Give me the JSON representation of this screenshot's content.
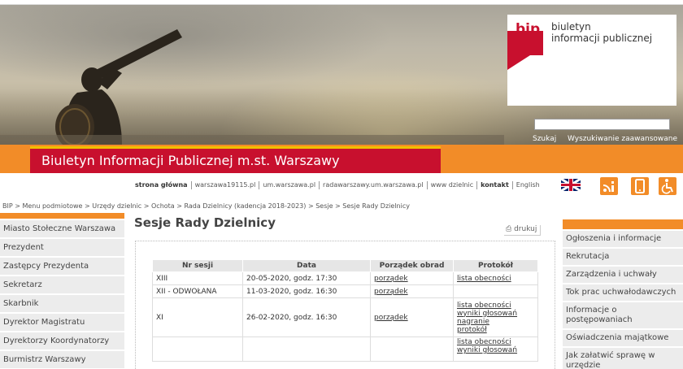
{
  "header": {
    "bip_logo_word": "bip",
    "bip_logo_text_line1": "biuletyn",
    "bip_logo_text_line2": "informacji publicznej",
    "search_label": "Szukaj",
    "advanced_search_label": "Wyszukiwanie zaawansowane",
    "site_title": "Biuletyn Informacji Publicznej m.st. Warszawy"
  },
  "topnav": {
    "items": [
      "strona główna",
      "warszawa19115.pl",
      "um.warszawa.pl",
      "radawarszawy.um.warszawa.pl",
      "www dzielnic",
      "kontakt",
      "English"
    ]
  },
  "icons": {
    "rss": "rss-icon",
    "mobile": "mobile-icon",
    "accessibility": "accessibility-icon",
    "flag": "uk-flag-icon",
    "print": "print-icon"
  },
  "breadcrumb": {
    "items": [
      "BIP",
      "Menu podmiotowe",
      "Urzędy dzielnic",
      "Ochota",
      "Rada Dzielnicy (kadencja 2018-2023)",
      "Sesje",
      "Sesje Rady Dzielnicy"
    ],
    "separator": ">"
  },
  "left_sidebar": {
    "items": [
      "Miasto Stołeczne Warszawa",
      "Prezydent",
      "Zastępcy Prezydenta",
      "Sekretarz",
      "Skarbnik",
      "Dyrektor Magistratu",
      "Dyrektorzy Koordynatorzy",
      "Burmistrz Warszawy"
    ]
  },
  "main": {
    "title": "Sesje Rady Dzielnicy",
    "print_label": "drukuj",
    "table": {
      "headers": [
        "Nr sesji",
        "Data",
        "Porządek obrad",
        "Protokół"
      ],
      "rows": [
        {
          "nr": "XIII",
          "data": "20-05-2020, godz. 17:30",
          "porzadek": "porządek",
          "protokol": [
            "lista obecności"
          ]
        },
        {
          "nr": "XII - ODWOŁANA",
          "data": "11-03-2020, godz. 16:30",
          "porzadek": "porządek",
          "protokol": []
        },
        {
          "nr": "XI",
          "data": "26-02-2020, godz. 16:30",
          "porzadek": "porządek",
          "protokol": [
            "lista obecności",
            "wyniki głosowań",
            "nagranie",
            "protokół"
          ]
        },
        {
          "nr": "",
          "data": "",
          "porzadek": "",
          "protokol": [
            "lista obecności",
            "wyniki głosowań"
          ]
        }
      ]
    }
  },
  "right_sidebar": {
    "items": [
      "Ogłoszenia i informacje",
      "Rekrutacja",
      "Zarządzenia i uchwały",
      "Tok prac uchwałodawczych",
      "Informacje o postępowaniach",
      "Oświadczenia majątkowe",
      "Jak załatwić sprawę w urzędzie"
    ]
  },
  "colors": {
    "orange": "#f28c28",
    "red": "#c8102e",
    "gold": "#f0c000"
  }
}
